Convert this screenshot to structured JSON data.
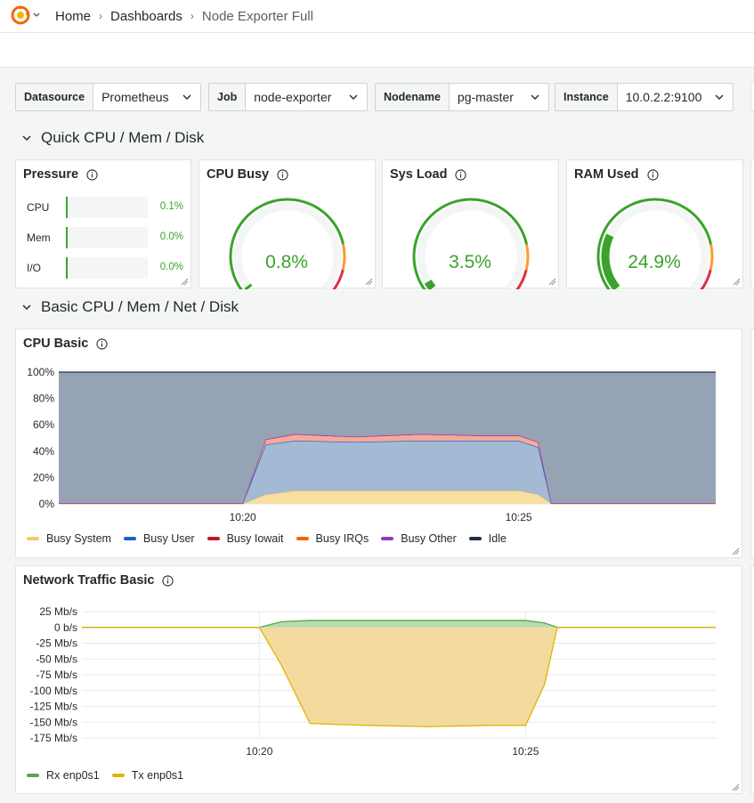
{
  "breadcrumb": {
    "home": "Home",
    "dashboards": "Dashboards",
    "current": "Node Exporter Full"
  },
  "variables": [
    {
      "label": "Datasource",
      "value": "Prometheus"
    },
    {
      "label": "Job",
      "value": "node-exporter"
    },
    {
      "label": "Nodename",
      "value": "pg-master"
    },
    {
      "label": "Instance",
      "value": "10.0.2.2:9100"
    }
  ],
  "rows": {
    "quick": "Quick CPU / Mem / Disk",
    "basic": "Basic CPU / Mem / Net / Disk"
  },
  "pressure": {
    "title": "Pressure",
    "items": [
      {
        "label": "CPU",
        "value": "0.1%",
        "fraction": 0.001
      },
      {
        "label": "Mem",
        "value": "0.0%",
        "fraction": 0.0
      },
      {
        "label": "I/O",
        "value": "0.0%",
        "fraction": 0.0
      }
    ]
  },
  "gauges": [
    {
      "title": "CPU Busy",
      "value": "0.8%",
      "fraction": 0.008
    },
    {
      "title": "Sys Load",
      "value": "3.5%",
      "fraction": 0.035
    },
    {
      "title": "RAM Used",
      "value": "24.9%",
      "fraction": 0.249
    }
  ],
  "cpu_panel": {
    "title": "CPU Basic"
  },
  "net_panel": {
    "title": "Network Traffic Basic"
  },
  "colors": {
    "green": "#3aa32c",
    "busy_system": "#f2c96d",
    "busy_user": "#1f60c4",
    "busy_iowait": "#c4162a",
    "busy_irqs": "#fa6400",
    "busy_other": "#8f3bb8",
    "idle": "#203049",
    "rx": "#56a64b",
    "tx": "#e0b400"
  },
  "chart_data": [
    {
      "type": "area",
      "title": "CPU Basic",
      "x": [
        "10:17",
        "10:18",
        "10:19",
        "10:20",
        "10:20:30",
        "10:21",
        "10:22",
        "10:23",
        "10:24",
        "10:25",
        "10:25:30",
        "10:26",
        "10:27",
        "10:28"
      ],
      "x_ticks": [
        "10:20",
        "10:25"
      ],
      "y_ticks": [
        "0%",
        "20%",
        "40%",
        "60%",
        "80%",
        "100%"
      ],
      "ylim": [
        0,
        100
      ],
      "series": [
        {
          "name": "Busy System",
          "values": [
            0,
            0,
            0,
            0,
            7,
            10,
            10,
            10,
            10,
            10,
            7,
            0,
            0,
            0
          ]
        },
        {
          "name": "Busy User",
          "values": [
            0.5,
            0.5,
            0.5,
            0.5,
            38,
            38,
            37,
            38,
            38,
            38,
            36,
            0.5,
            0.5,
            0.5
          ]
        },
        {
          "name": "Busy Iowait",
          "values": [
            0,
            0,
            0,
            0,
            4,
            5,
            4,
            5,
            4,
            4,
            4,
            0,
            0,
            0
          ]
        },
        {
          "name": "Busy IRQs",
          "values": [
            0,
            0,
            0,
            0,
            0,
            0,
            0,
            0,
            0,
            0,
            0,
            0,
            0,
            0
          ]
        },
        {
          "name": "Busy Other",
          "values": [
            0,
            0,
            0,
            0,
            0,
            0,
            0,
            0,
            0,
            0,
            0,
            0,
            0,
            0
          ]
        },
        {
          "name": "Idle",
          "values": [
            99.5,
            99.5,
            99.5,
            99.5,
            51,
            47,
            49,
            47,
            48,
            48,
            53,
            99.5,
            99.5,
            99.5
          ]
        }
      ]
    },
    {
      "type": "area",
      "title": "Network Traffic Basic",
      "x": [
        "10:17",
        "10:18",
        "10:19",
        "10:20",
        "10:20:30",
        "10:21",
        "10:22",
        "10:23",
        "10:24",
        "10:25",
        "10:25:30",
        "10:26",
        "10:27",
        "10:28"
      ],
      "x_ticks": [
        "10:20",
        "10:25"
      ],
      "y_ticks": [
        "25 Mb/s",
        "0 b/s",
        "-25 Mb/s",
        "-50 Mb/s",
        "-75 Mb/s",
        "-100 Mb/s",
        "-125 Mb/s",
        "-150 Mb/s",
        "-175 Mb/s"
      ],
      "ylim": [
        -175,
        25
      ],
      "series": [
        {
          "name": "Rx enp0s1",
          "values": [
            0,
            0,
            0,
            0,
            9,
            11,
            11,
            11,
            11,
            11,
            7,
            0,
            0,
            0
          ]
        },
        {
          "name": "Tx enp0s1",
          "values": [
            0,
            0,
            0,
            0,
            -60,
            -152,
            -155,
            -157,
            -155,
            -155,
            -90,
            0,
            0,
            0
          ]
        }
      ]
    }
  ]
}
